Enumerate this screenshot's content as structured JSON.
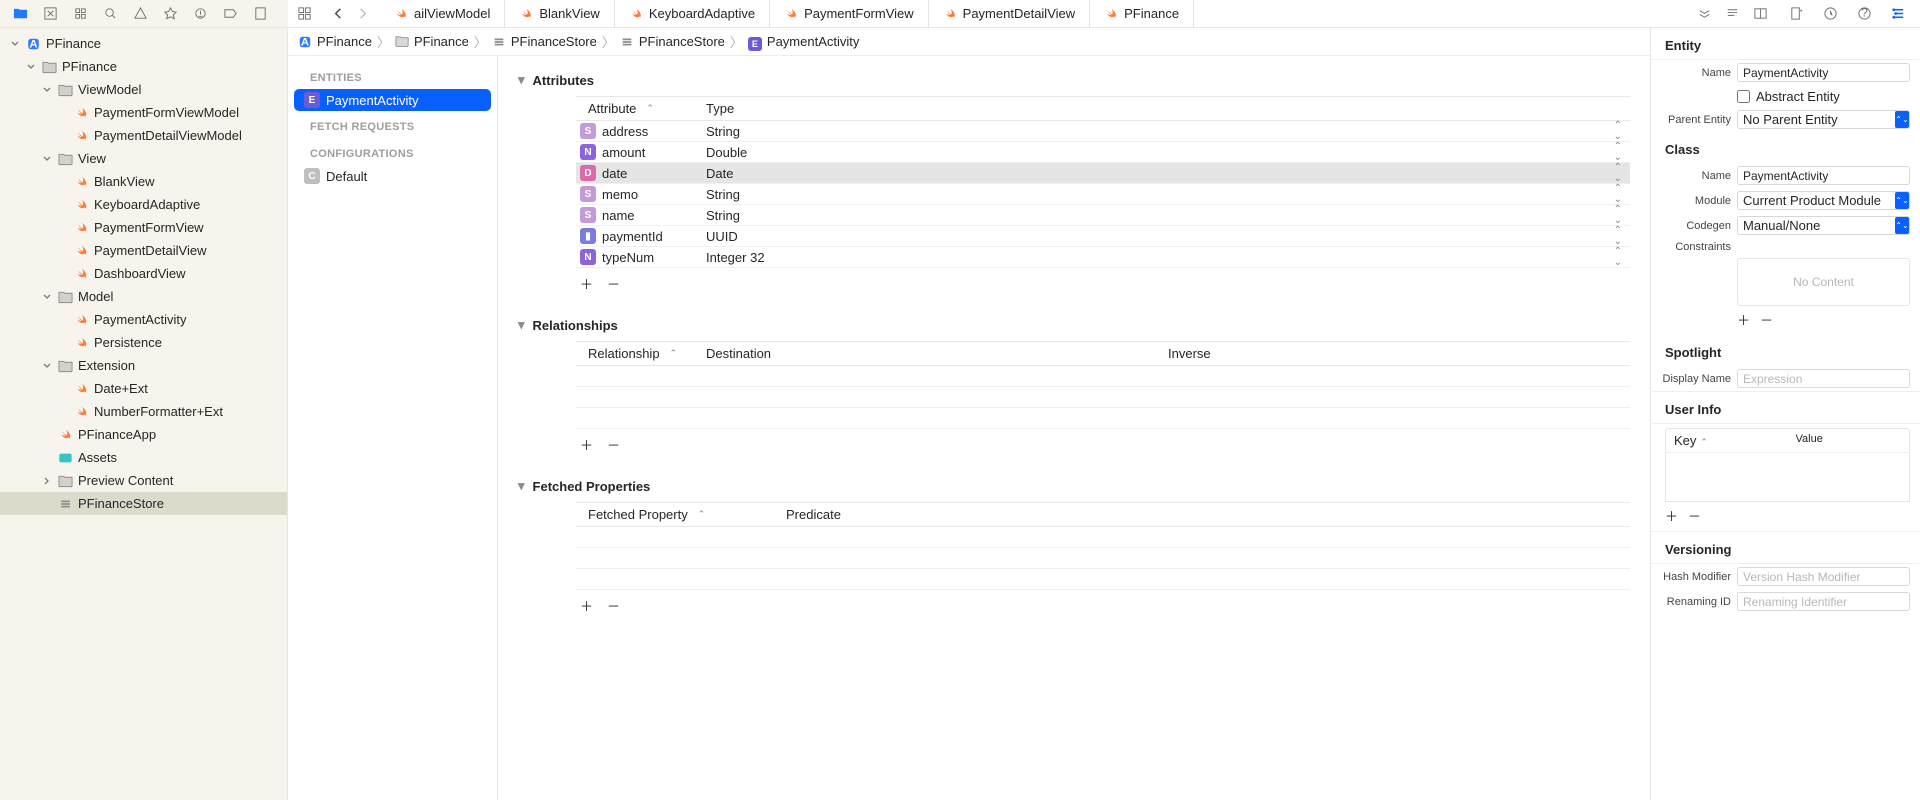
{
  "toolbar_tabs": [
    {
      "label": "ailViewModel",
      "icon": "swift"
    },
    {
      "label": "BlankView",
      "icon": "swift"
    },
    {
      "label": "KeyboardAdaptive",
      "icon": "swift"
    },
    {
      "label": "PaymentFormView",
      "icon": "swift"
    },
    {
      "label": "PaymentDetailView",
      "icon": "swift"
    },
    {
      "label": "PFinance",
      "icon": "swift"
    }
  ],
  "project_root": "PFinance",
  "nav_tree": {
    "root": "PFinance",
    "groups": [
      {
        "name": "ViewModel",
        "files": [
          "PaymentFormViewModel",
          "PaymentDetailViewModel"
        ]
      },
      {
        "name": "View",
        "files": [
          "BlankView",
          "KeyboardAdaptive",
          "PaymentFormView",
          "PaymentDetailView",
          "DashboardView"
        ]
      },
      {
        "name": "Model",
        "files": [
          "PaymentActivity",
          "Persistence"
        ]
      },
      {
        "name": "Extension",
        "files": [
          "Date+Ext",
          "NumberFormatter+Ext"
        ]
      }
    ],
    "tail": [
      "PFinanceApp",
      "Assets",
      "Preview Content",
      "PFinanceStore"
    ]
  },
  "entity_nav": {
    "entities_label": "ENTITIES",
    "entity_name": "PaymentActivity",
    "fetch_label": "FETCH REQUESTS",
    "config_label": "CONFIGURATIONS",
    "config_default": "Default"
  },
  "breadcrumb": [
    "PFinance",
    "PFinance",
    "PFinanceStore",
    "PFinanceStore",
    "PaymentActivity"
  ],
  "sections": {
    "attributes": {
      "title": "Attributes",
      "col1": "Attribute",
      "col2": "Type",
      "rows": [
        {
          "k": "S",
          "color": "#c39bd8",
          "name": "address",
          "type": "String"
        },
        {
          "k": "N",
          "color": "#8c66d9",
          "name": "amount",
          "type": "Double"
        },
        {
          "k": "D",
          "color": "#d96ca8",
          "name": "date",
          "type": "Date",
          "sel": true
        },
        {
          "k": "S",
          "color": "#c39bd8",
          "name": "memo",
          "type": "String"
        },
        {
          "k": "S",
          "color": "#c39bd8",
          "name": "name",
          "type": "String"
        },
        {
          "k": "▮",
          "color": "#7c7ce0",
          "name": "paymentId",
          "type": "UUID"
        },
        {
          "k": "N",
          "color": "#8c66d9",
          "name": "typeNum",
          "type": "Integer 32"
        }
      ]
    },
    "relationships": {
      "title": "Relationships",
      "col1": "Relationship",
      "col2": "Destination",
      "col3": "Inverse"
    },
    "fetched": {
      "title": "Fetched Properties",
      "col1": "Fetched Property",
      "col2": "Predicate"
    }
  },
  "inspector": {
    "entity_head": "Entity",
    "name_label": "Name",
    "name_value": "PaymentActivity",
    "abstract_label": "Abstract Entity",
    "parent_label": "Parent Entity",
    "parent_value": "No Parent Entity",
    "class_head": "Class",
    "class_name_value": "PaymentActivity",
    "module_label": "Module",
    "module_value": "Current Product Module",
    "codegen_label": "Codegen",
    "codegen_value": "Manual/None",
    "constraints_label": "Constraints",
    "constraints_empty": "No Content",
    "spotlight_head": "Spotlight",
    "display_label": "Display Name",
    "display_placeholder": "Expression",
    "userinfo_head": "User Info",
    "key_label": "Key",
    "value_label": "Value",
    "versioning_head": "Versioning",
    "hash_label": "Hash Modifier",
    "hash_placeholder": "Version Hash Modifier",
    "rename_label": "Renaming ID",
    "rename_placeholder": "Renaming Identifier"
  }
}
